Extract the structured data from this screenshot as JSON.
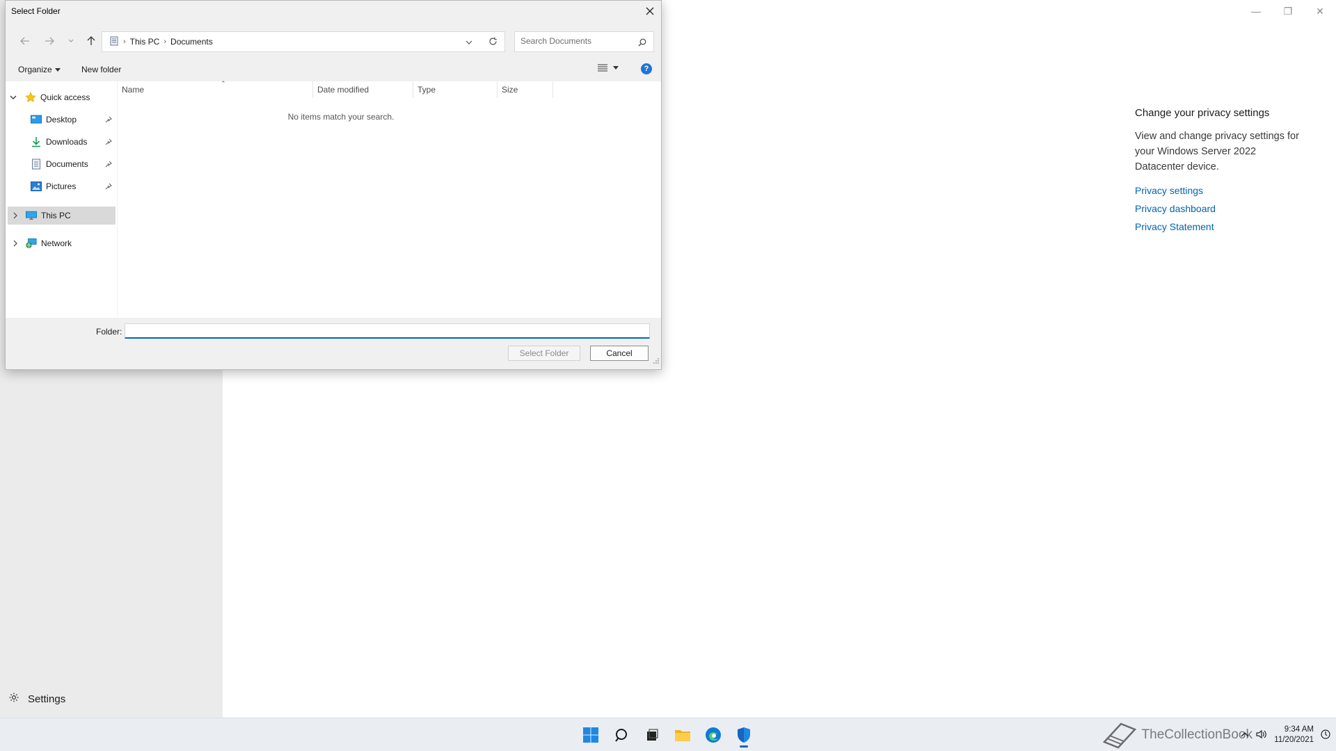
{
  "dialog": {
    "title": "Select Folder",
    "breadcrumb": [
      "This PC",
      "Documents"
    ],
    "search_placeholder": "Search Documents",
    "toolbar": {
      "organize_label": "Organize",
      "new_folder_label": "New folder"
    },
    "tree": {
      "quick_access": "Quick access",
      "pinned": [
        "Desktop",
        "Downloads",
        "Documents",
        "Pictures"
      ],
      "this_pc": "This PC",
      "network": "Network"
    },
    "columns": [
      "Name",
      "Date modified",
      "Type",
      "Size"
    ],
    "empty_message": "No items match your search.",
    "folder_label": "Folder:",
    "folder_value": "",
    "select_button": "Select Folder",
    "cancel_button": "Cancel"
  },
  "settings": {
    "nav_settings": "Settings",
    "privacy": {
      "title": "Change your privacy settings",
      "description": "View and change privacy settings for your Windows Server 2022 Datacenter device.",
      "links": [
        "Privacy settings",
        "Privacy dashboard",
        "Privacy Statement"
      ]
    }
  },
  "taskbar": {
    "time": "9:34 AM",
    "date": "11/20/2021",
    "watermark": "TheCollectionBook",
    "accent_color": "#0067c0"
  }
}
